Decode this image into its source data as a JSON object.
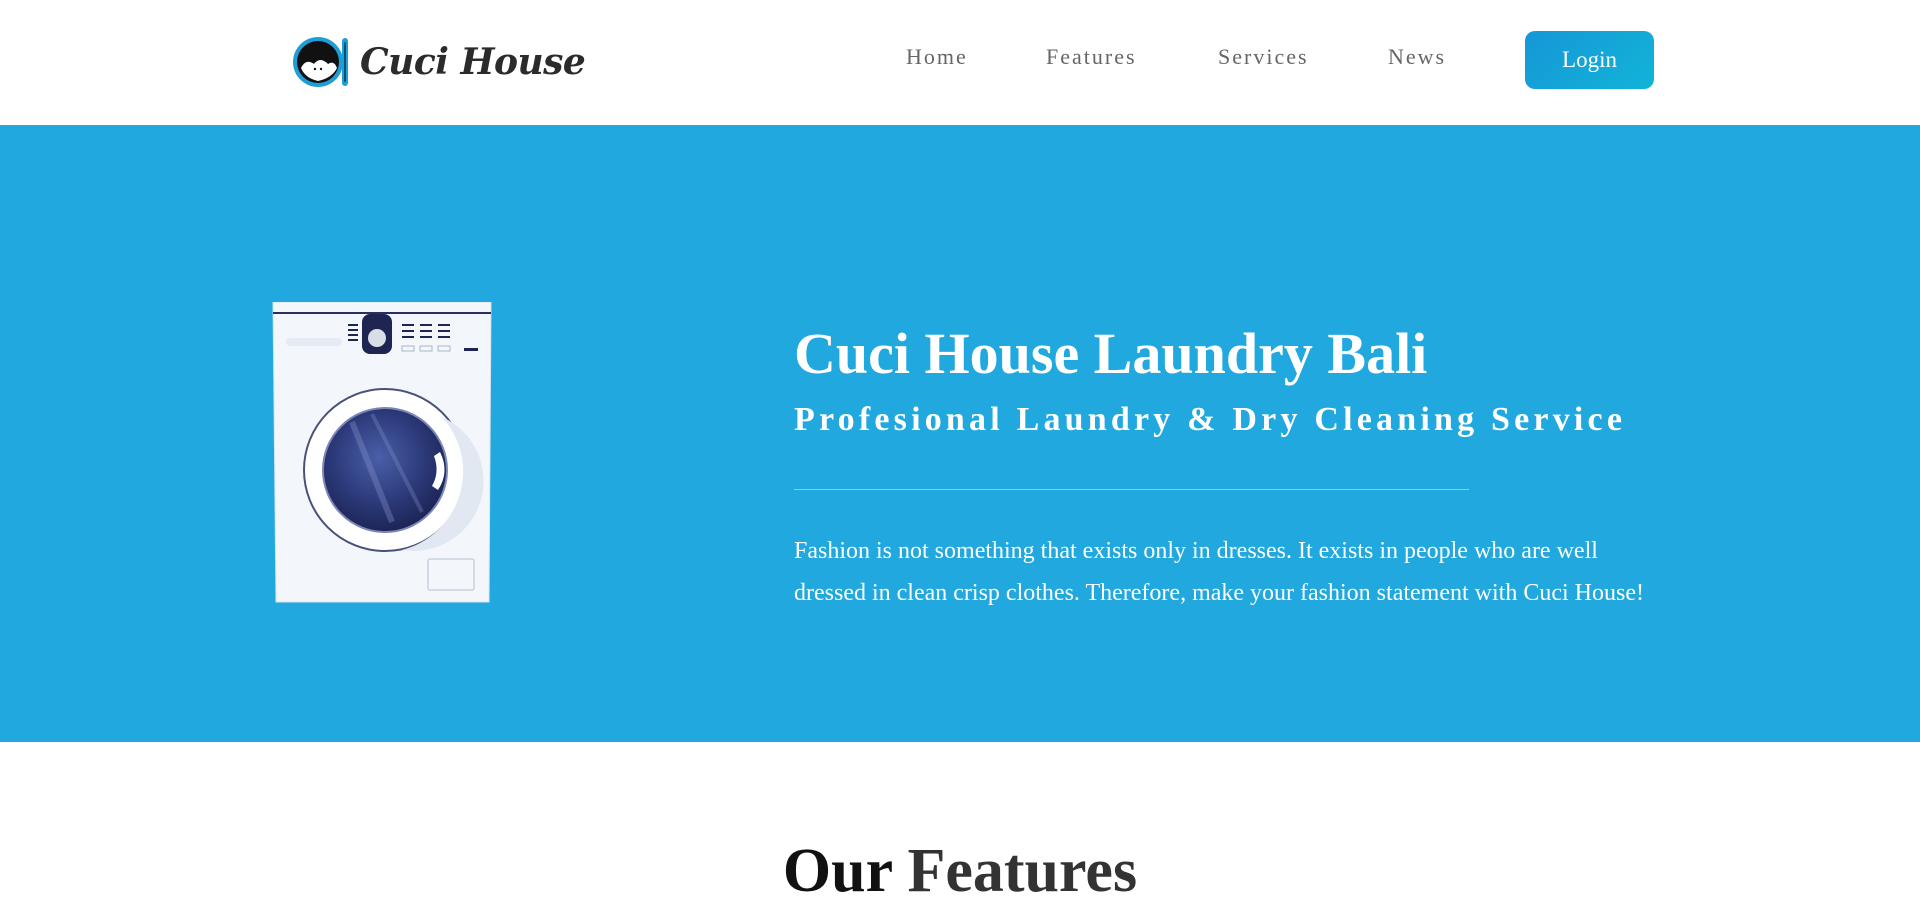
{
  "header": {
    "logo_text": "Cuci House",
    "nav": [
      {
        "label": "Home"
      },
      {
        "label": "Features"
      },
      {
        "label": "Services"
      },
      {
        "label": "News"
      }
    ],
    "login_label": "Login"
  },
  "hero": {
    "title": "Cuci House Laundry Bali",
    "subtitle": "Profesional Laundry & Dry Cleaning Service",
    "text": "Fashion is not something that exists only in dresses. It exists in people who are well dressed in clean crisp clothes. Therefore, make your fashion statement with Cuci House!"
  },
  "features": {
    "heading_bold": "Our",
    "heading_rest": "Features"
  },
  "colors": {
    "hero_bg": "#21a8de",
    "button": "#1597d6",
    "nav_text": "#666666"
  },
  "icons": {
    "logo": "washing-machine-logo-icon",
    "hero_image": "washing-machine-illustration"
  }
}
